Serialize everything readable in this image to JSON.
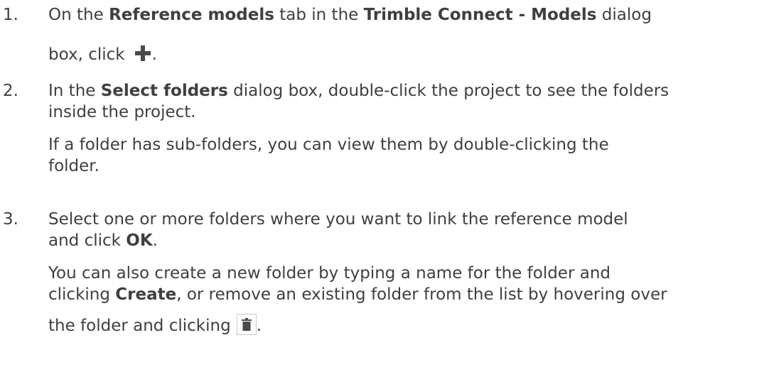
{
  "steps": [
    {
      "number": "1.",
      "l1_a": "On the ",
      "l1_b": "Reference models",
      "l1_c": " tab in the ",
      "l1_d": "Trimble Connect - Models",
      "l1_e": " dialog",
      "l2_a": "box, click",
      "l2_end": ".",
      "icon": "plus-icon"
    },
    {
      "number": "2.",
      "l1_a": "In the ",
      "l1_b": "Select folders",
      "l1_c": " dialog box, double-click the project to see the folders",
      "l2": "inside the project.",
      "p2_l1": "If a folder has sub-folders, you can view them by double-clicking the",
      "p2_l2": "folder."
    },
    {
      "number": "3.",
      "l1": "Select one or more folders where you want to link the reference model",
      "l2_a": "and click ",
      "l2_b": "OK",
      "l2_c": ".",
      "p2_l1": "You can also create a new folder by typing a name for the folder and",
      "p2_l2_a": "clicking ",
      "p2_l2_b": "Create",
      "p2_l2_c": ", or remove an existing folder from the list by hovering over",
      "p2_l3": "the folder and clicking",
      "p2_end": ".",
      "icon": "trash-icon"
    }
  ]
}
